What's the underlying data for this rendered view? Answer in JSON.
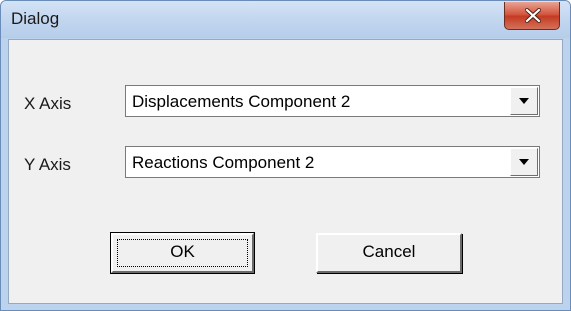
{
  "window": {
    "title": "Dialog",
    "close_icon": "close-icon"
  },
  "form": {
    "x_axis_label": "X Axis",
    "x_axis_value": "Displacements Component 2",
    "y_axis_label": "Y Axis",
    "y_axis_value": "Reactions Component 2",
    "dropdown_icon": "chevron-down-icon"
  },
  "buttons": {
    "ok_label": "OK",
    "cancel_label": "Cancel"
  },
  "colors": {
    "close_button": "#c9442a",
    "titlebar": "#c2d6ef",
    "client_background": "#f0f0f0"
  }
}
